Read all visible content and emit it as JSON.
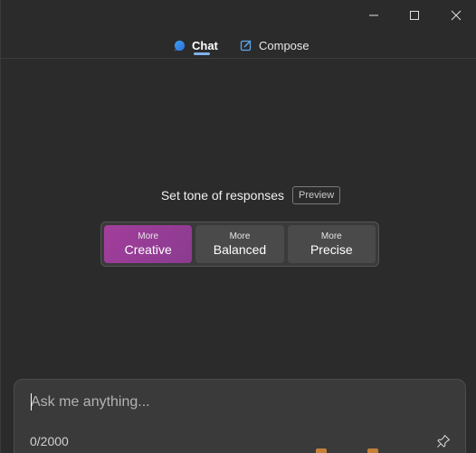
{
  "tabs": [
    {
      "label": "Chat",
      "icon": "chat-bubble-icon",
      "active": true
    },
    {
      "label": "Compose",
      "icon": "compose-icon",
      "active": false
    }
  ],
  "tone": {
    "title": "Set tone of responses",
    "badge": "Preview",
    "options": [
      {
        "prefix": "More",
        "label": "Creative",
        "selected": true
      },
      {
        "prefix": "More",
        "label": "Balanced",
        "selected": false
      },
      {
        "prefix": "More",
        "label": "Precise",
        "selected": false
      }
    ]
  },
  "input": {
    "placeholder": "Ask me anything...",
    "value": "",
    "char_count": "0/2000"
  },
  "colors": {
    "background": "#2b2b2b",
    "accent_creative": "#a33e9c",
    "tab_indicator": "#7fb2f0"
  }
}
